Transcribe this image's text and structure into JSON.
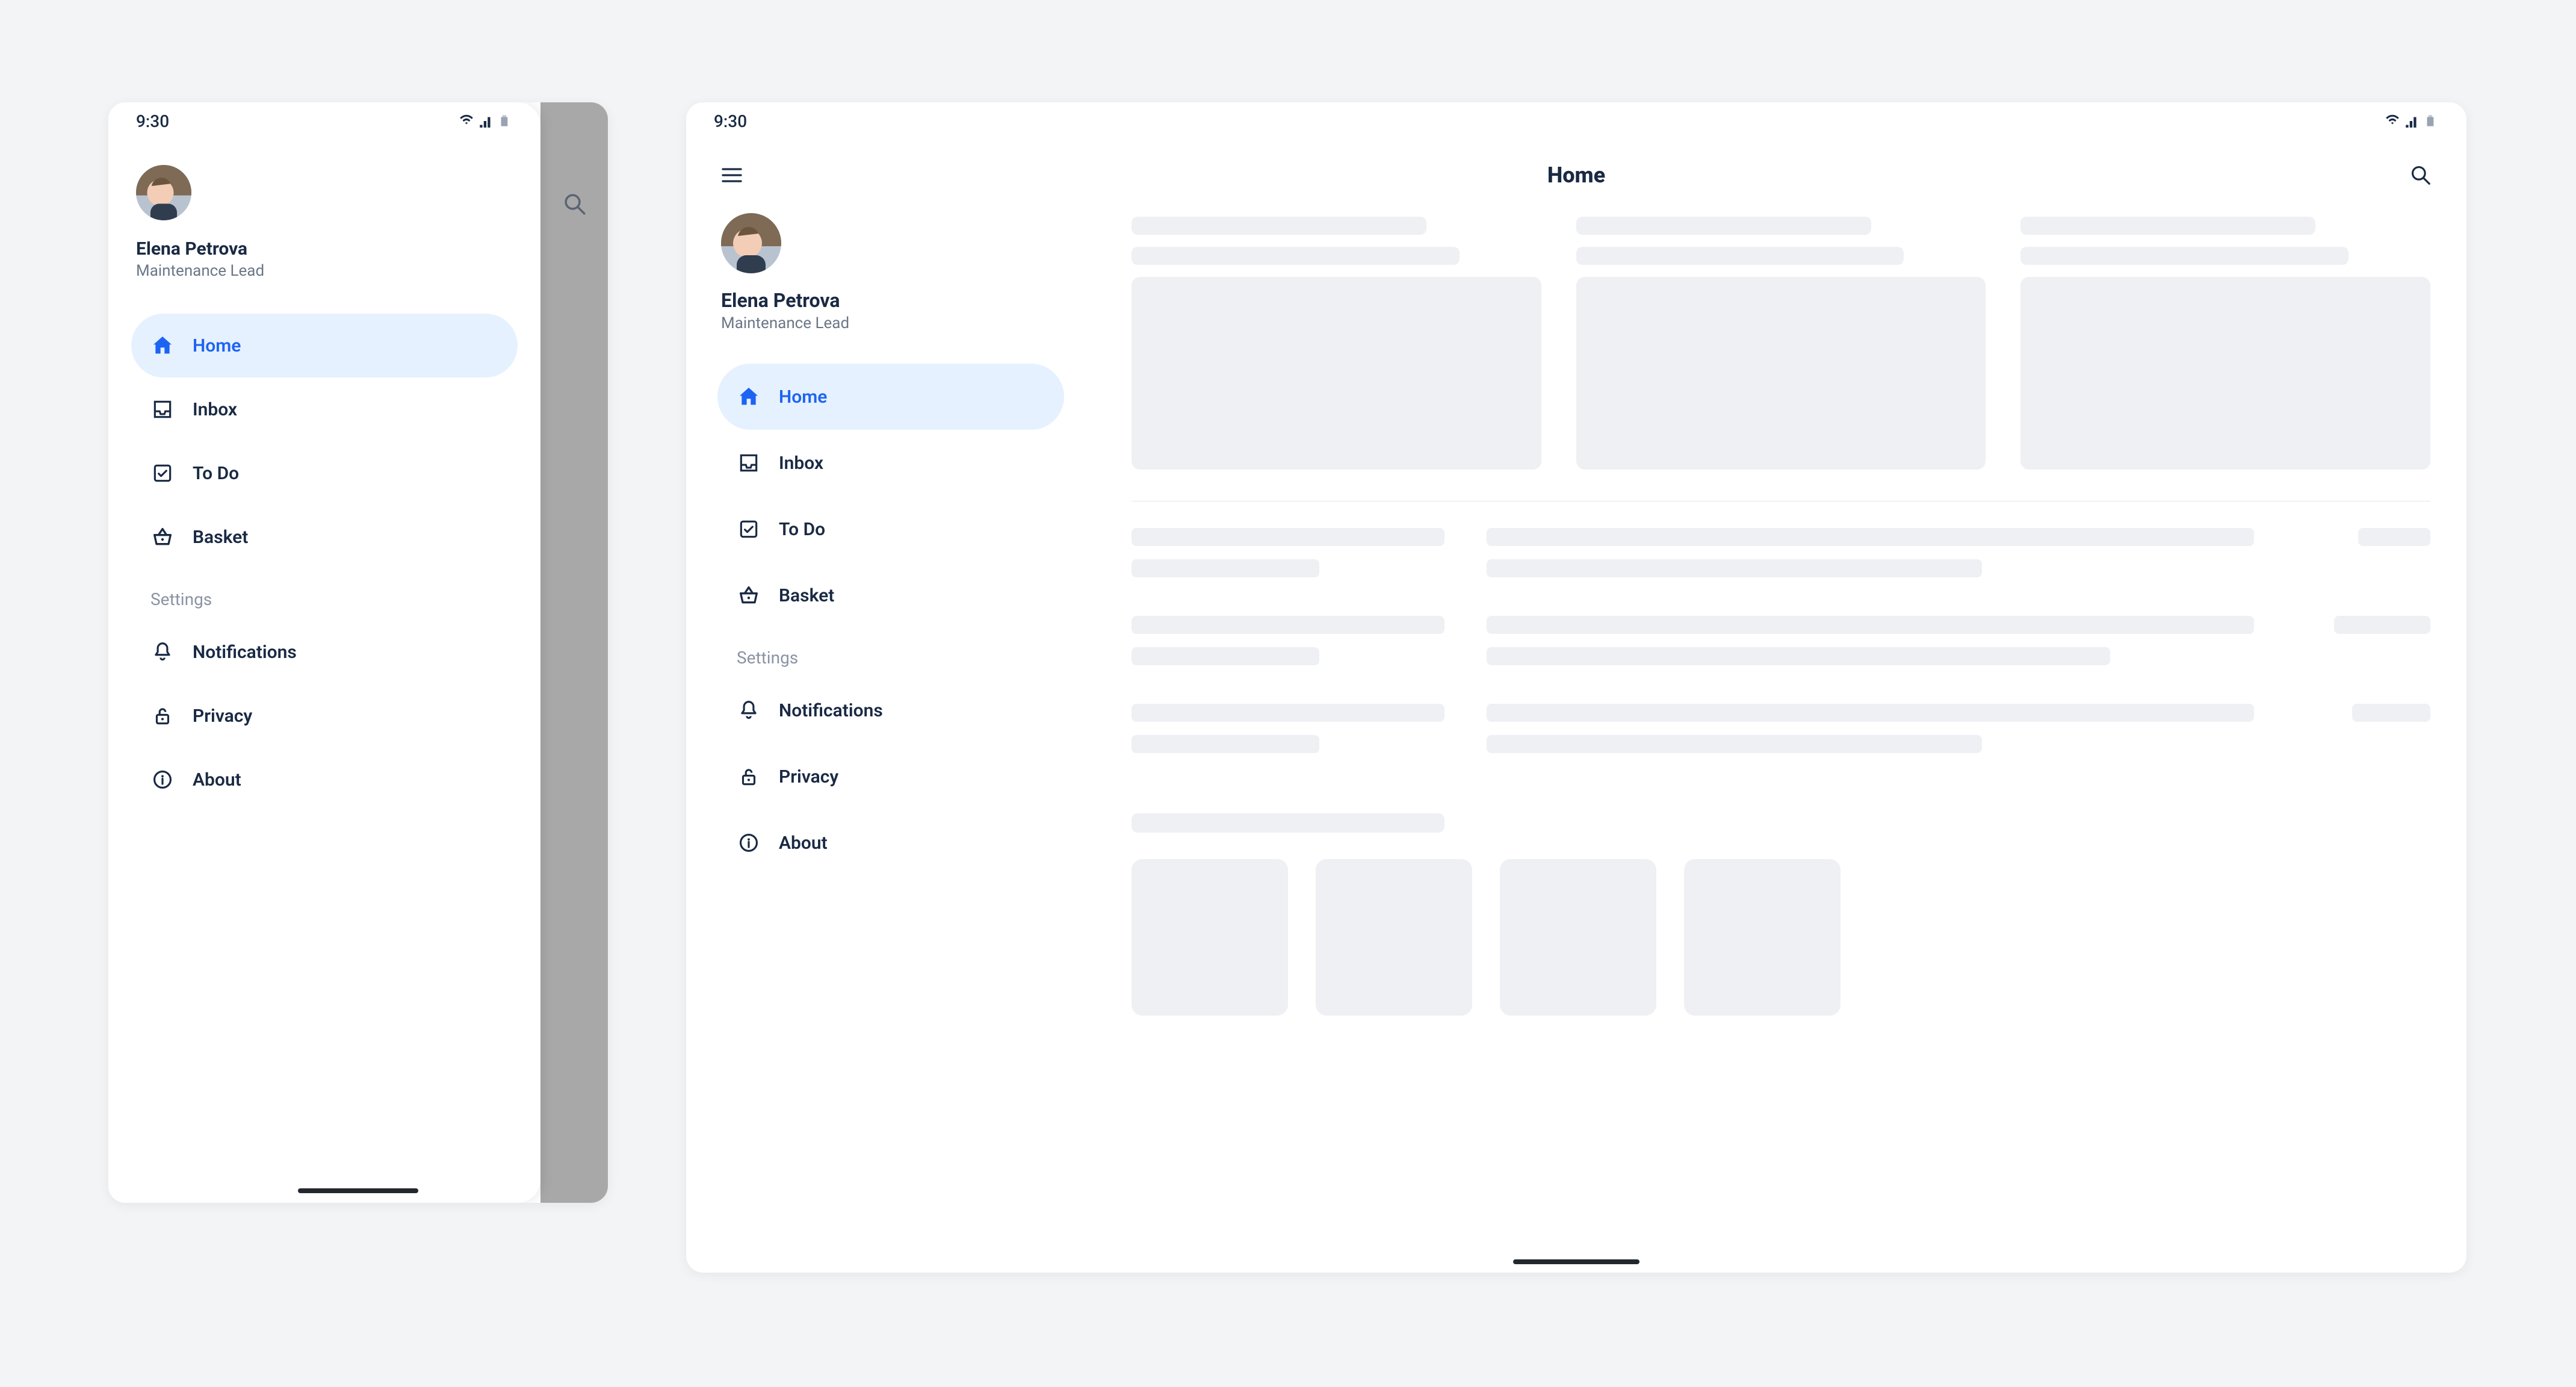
{
  "status": {
    "time": "9:30"
  },
  "page": {
    "title": "Home"
  },
  "profile": {
    "name": "Elena Petrova",
    "role": "Maintenance Lead"
  },
  "nav": {
    "items": [
      {
        "id": "home",
        "label": "Home",
        "icon": "home-icon",
        "active": true
      },
      {
        "id": "inbox",
        "label": "Inbox",
        "icon": "inbox-icon",
        "active": false
      },
      {
        "id": "todo",
        "label": "To Do",
        "icon": "check-icon",
        "active": false
      },
      {
        "id": "basket",
        "label": "Basket",
        "icon": "basket-icon",
        "active": false
      }
    ],
    "section_label": "Settings",
    "settings": [
      {
        "id": "notifications",
        "label": "Notifications",
        "icon": "bell-icon"
      },
      {
        "id": "privacy",
        "label": "Privacy",
        "icon": "lock-icon"
      },
      {
        "id": "about",
        "label": "About",
        "icon": "info-icon"
      }
    ]
  },
  "colors": {
    "accent": "#1d64f2",
    "accent_bg": "#e6f1ff",
    "text": "#1a2a44",
    "muted": "#8a93a3",
    "skeleton": "#eef0f3"
  }
}
